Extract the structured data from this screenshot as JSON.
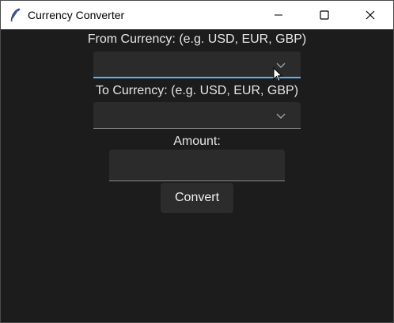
{
  "window": {
    "title": "Currency Converter",
    "icon": "feather-icon"
  },
  "titlebar_controls": [
    "minimize-icon",
    "maximize-icon",
    "close-icon"
  ],
  "form": {
    "from_label": "From Currency: (e.g. USD, EUR, GBP)",
    "from_value": "",
    "to_label": "To Currency: (e.g. USD, EUR, GBP)",
    "to_value": "",
    "amount_label": "Amount:",
    "amount_value": "",
    "convert_label": "Convert"
  },
  "colors": {
    "background": "#1c1c1c",
    "field": "#2b2b2b",
    "focus_accent": "#5fb2f2",
    "text": "#e6e6e6"
  }
}
